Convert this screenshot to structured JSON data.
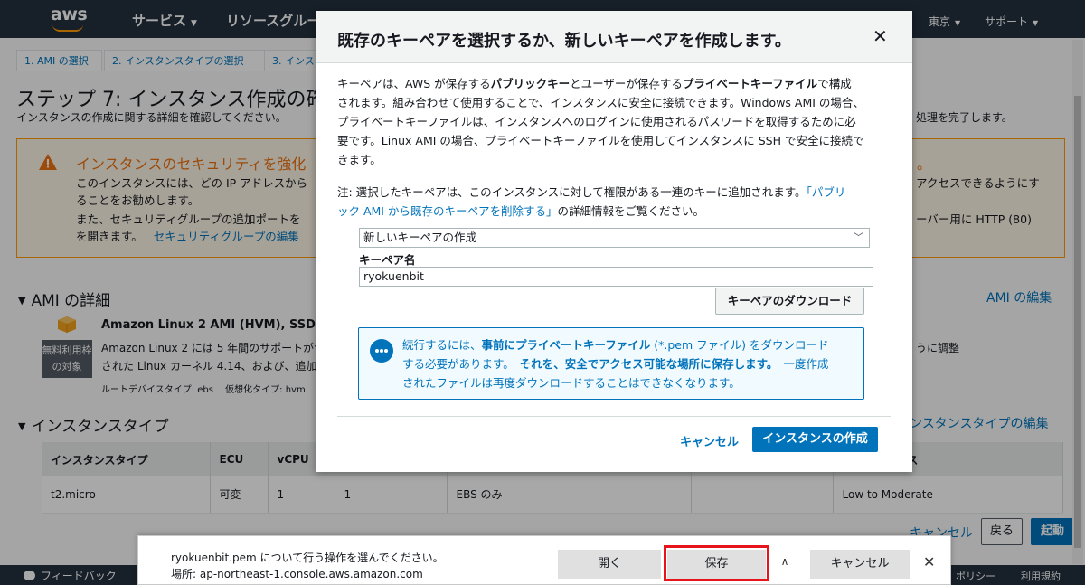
{
  "topnav": {
    "logo": "aws",
    "services": "サービス",
    "resource_groups": "リソースグルー",
    "region": "東京",
    "support": "サポート"
  },
  "wizard": {
    "tabs": [
      {
        "label": "1. AMI の選択"
      },
      {
        "label": "2. インスタンスタイプの選択"
      },
      {
        "label": "3. インス"
      }
    ]
  },
  "page": {
    "title": "ステップ 7: インスタンス作成の確",
    "subtitle": "インスタンスの作成に関する詳細を確認してください。",
    "subtitle_right": "処理を完了します。"
  },
  "warning": {
    "title": "インスタンスのセキュリティを強化",
    "title_tail": "。",
    "line1": "このインスタンスには、どの IP アドレスから",
    "line1_right": "アクセスできるようにす",
    "line2": "ることをお勧めします。",
    "line3": "また、セキュリティグループの追加ポートを",
    "line3_right": "ーバー用に HTTP (80)",
    "line4": "を開きます。",
    "link": "セキュリティグループの編集"
  },
  "ami": {
    "section": "AMI の詳細",
    "edit": "AMI の編集",
    "name": "Amazon Linux 2 AMI (HVM), SSD Vo",
    "badge_line1": "無料利用枠",
    "badge_line2": "の対象",
    "desc1": "Amazon Linux 2 には 5 年間のサポートが含",
    "desc2": "された Linux カーネル 4.14、および、追加",
    "desc_right": "うに調整",
    "meta_root": "ルートデバイスタイプ: ebs",
    "meta_virt": "仮想化タイプ: hvm"
  },
  "instance_type": {
    "section": "インスタンスタイプ",
    "edit": "ンスタンスタイプの編集",
    "headers": [
      "インスタンスタイプ",
      "ECU",
      "vCPU",
      "",
      "",
      "",
      "パフォーマンス"
    ],
    "row": [
      "t2.micro",
      "可変",
      "1",
      "1",
      "EBS のみ",
      "-",
      "Low to Moderate"
    ]
  },
  "actions": {
    "cancel": "キャンセル",
    "prev": "戻る",
    "launch": "起動"
  },
  "footer": {
    "feedback": "フィードバック",
    "privacy": "ポリシー",
    "terms": "利用規約"
  },
  "modal": {
    "title": "既存のキーペアを選択するか、新しいキーペアを作成します。",
    "close": "✕",
    "para1_lines": [
      [
        "キーペアは、AWS が保存する",
        "パブリックキー",
        "とユーザーが保存する",
        "プライベートキーファイル",
        "で構成"
      ],
      [
        "されます。組み合わせて使用することで、インスタンスに安全に接続できます。Windows AMI の場合、"
      ],
      [
        "プライベートキーファイルは、インスタンスへのログインに使用されるパスワードを取得するために必"
      ],
      [
        "要です。Linux AMI の場合、プライベートキーファイルを使用してインスタンスに SSH で安全に接続で"
      ],
      [
        "きます。"
      ]
    ],
    "para2_line1": "注: 選択したキーペアは、このインスタンスに対して権限がある一連のキーに追加されます。",
    "para2_link1": "「パブリ",
    "para2_link2": "ック AMI から既存のキーペアを削除する」",
    "para2_tail": "の詳細情報をご覧ください。",
    "select_value": "新しいキーペアの作成",
    "keypair_label": "キーペア名",
    "keypair_value": "ryokuenbit",
    "download": "キーペアのダウンロード",
    "info": {
      "l1a": "続行するには、",
      "l1b": "事前にプライベートキーファイル",
      "l1c": " (*.pem ファイル) をダウンロード",
      "l2a": "する必要があります。",
      "l2b": "それを、安全でアクセス可能な場所に保存します。",
      "l2c": "一度作成",
      "l3": "されたファイルは再度ダウンロードすることはできなくなります。"
    },
    "cancel": "キャンセル",
    "create": "インスタンスの作成"
  },
  "download_bar": {
    "message": "ryokuenbit.pem について行う操作を選んでください。",
    "source": "場所: ap-northeast-1.console.aws.amazon.com",
    "open": "開く",
    "save": "保存",
    "cancel": "キャンセル",
    "close": "✕",
    "chevron": "∧"
  }
}
